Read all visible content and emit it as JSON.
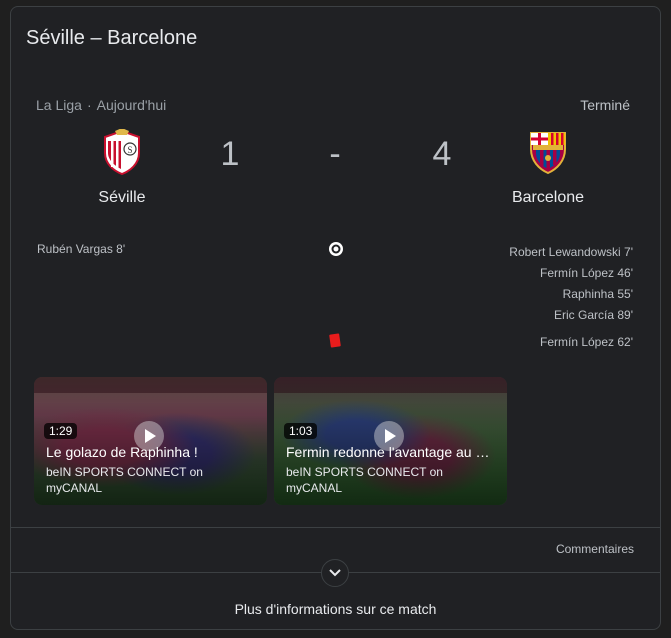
{
  "match": {
    "title": "Séville – Barcelone",
    "league": "La Liga",
    "separator": "·",
    "date": "Aujourd'hui",
    "status": "Terminé"
  },
  "home": {
    "name": "Séville",
    "score": "1",
    "crest_icon": "sevilla-crest-icon",
    "scorers": [
      "Rubén Vargas 8'"
    ]
  },
  "away": {
    "name": "Barcelone",
    "score": "4",
    "crest_icon": "barcelona-crest-icon",
    "scorers": [
      "Robert Lewandowski 7'",
      "Fermín López 46'",
      "Raphinha 55'",
      "Eric García 89'"
    ],
    "red_cards": [
      "Fermín López 62'"
    ]
  },
  "score_separator": "-",
  "videos": [
    {
      "duration": "1:29",
      "title": "Le golazo de Raphinha !",
      "source": "beIN SPORTS CONNECT on myCANAL"
    },
    {
      "duration": "1:03",
      "title": "Fermin redonne l'avantage au …",
      "source": "beIN SPORTS CONNECT on myCANAL"
    }
  ],
  "footer": {
    "comments": "Commentaires",
    "more_info": "Plus d'informations sur ce match"
  },
  "colors": {
    "background": "#202124",
    "text": "#e8eaed",
    "muted": "#9aa0a6",
    "red_card": "#e81c1c"
  }
}
